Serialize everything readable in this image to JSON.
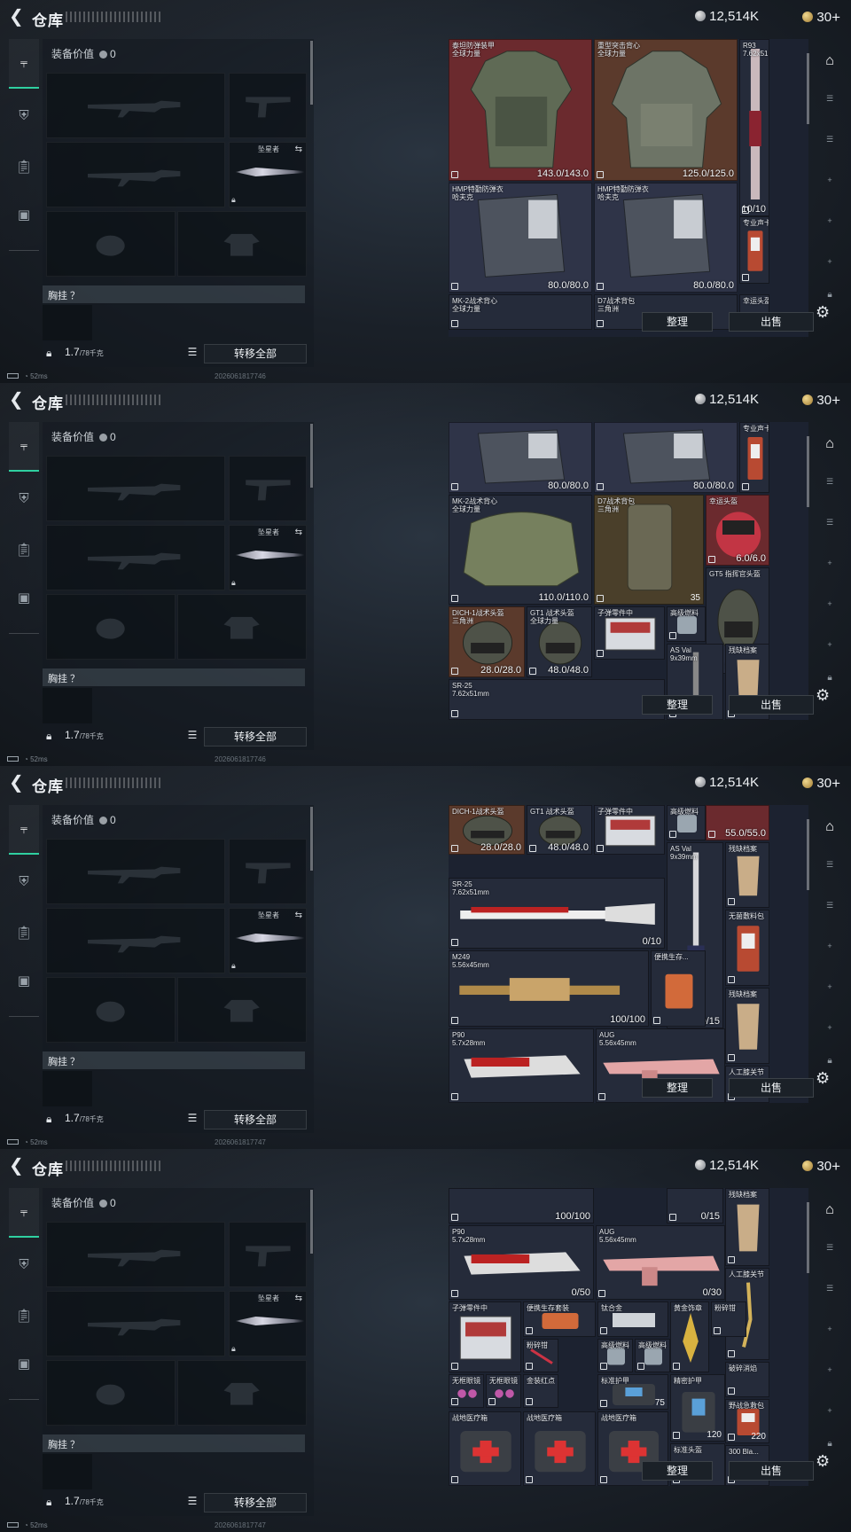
{
  "header": {
    "title": "仓库",
    "currency_silver": "12,514K",
    "currency_gold": "30"
  },
  "loadout": {
    "equip_value_label": "装备价值",
    "equip_value": "0",
    "melee_name": "坠星者",
    "vest_label": "胸挂 ？",
    "weight": "1.7",
    "weight_max": "/78千克",
    "transfer_all": "转移全部"
  },
  "actions": {
    "sort": "整理",
    "sell": "出售"
  },
  "status": {
    "ping": "52ms",
    "timestamps": [
      "2026061817746",
      "2026061817746",
      "2026061817747",
      "2026061817747"
    ]
  },
  "frames": [
    {
      "cells": [
        {
          "name": "泰坦防弹装甲\n全球力量",
          "value": "143.0/143.0"
        },
        {
          "name": "重型突击背心\n全球力量",
          "value": "125.0/125.0"
        },
        {
          "name": "R93\n7.62x51...",
          "value": "10/10"
        },
        {
          "name": "HMP特勤防弹衣\n哈夫克",
          "value": "80.0/80.0"
        },
        {
          "name": "HMP特勤防弹衣\n哈夫克",
          "value": "80.0/80.0"
        },
        {
          "name": "专业声卡",
          "value": ""
        },
        {
          "name": "MK-2战术背心\n全球力量",
          "value": ""
        },
        {
          "name": "D7战术背包\n三角洲",
          "value": ""
        },
        {
          "name": "幸运头盔",
          "value": ""
        }
      ]
    },
    {
      "cells": [
        {
          "name": "",
          "value": "80.0/80.0"
        },
        {
          "name": "",
          "value": "80.0/80.0"
        },
        {
          "name": "专业声卡",
          "value": ""
        },
        {
          "name": "MK-2战术背心\n全球力量",
          "value": "110.0/110.0"
        },
        {
          "name": "D7战术背包\n三角洲",
          "value": "35"
        },
        {
          "name": "幸运头盔",
          "value": "6.0/6.0"
        },
        {
          "name": "GT5 指挥官头盔",
          "value": "55.0/55.0"
        },
        {
          "name": "DICH-1战术头盔\n三角洲",
          "value": "28.0/28.0"
        },
        {
          "name": "GT1 战术头盔\n全球力量",
          "value": "48.0/48.0"
        },
        {
          "name": "子弹零件中",
          "value": ""
        },
        {
          "name": "高级燃料",
          "value": ""
        },
        {
          "name": "AS Val\n9x39mm",
          "value": ""
        },
        {
          "name": "残缺档案",
          "value": ""
        },
        {
          "name": "SR-25\n7.62x51mm",
          "value": ""
        }
      ]
    },
    {
      "cells": [
        {
          "name": "DICH-1战术头盔",
          "value": "28.0/28.0"
        },
        {
          "name": "GT1 战术头盔",
          "value": "48.0/48.0"
        },
        {
          "name": "子弹零件中",
          "value": ""
        },
        {
          "name": "高级燃料",
          "value": ""
        },
        {
          "name": "",
          "value": "55.0/55.0"
        },
        {
          "name": "AS Val\n9x39mm",
          "value": "0/15"
        },
        {
          "name": "残缺档案",
          "value": ""
        },
        {
          "name": "SR-25\n7.62x51mm",
          "value": "0/10"
        },
        {
          "name": "无菌敷料包",
          "value": ""
        },
        {
          "name": "M249\n5.56x45mm",
          "value": "100/100"
        },
        {
          "name": "便携生存...",
          "value": ""
        },
        {
          "name": "残缺档案",
          "value": ""
        },
        {
          "name": "P90\n5.7x28mm",
          "value": ""
        },
        {
          "name": "AUG\n5.56x45mm",
          "value": ""
        },
        {
          "name": "人工膝关节",
          "value": ""
        }
      ]
    },
    {
      "cells": [
        {
          "name": "",
          "value": "100/100"
        },
        {
          "name": "",
          "value": "0/15"
        },
        {
          "name": "残缺档案",
          "value": ""
        },
        {
          "name": "P90\n5.7x28mm",
          "value": "0/50"
        },
        {
          "name": "AUG\n5.56x45mm",
          "value": "0/30"
        },
        {
          "name": "人工膝关节",
          "value": ""
        },
        {
          "name": "子弹零件中",
          "value": ""
        },
        {
          "name": "便携生存套装",
          "value": ""
        },
        {
          "name": "钛合金",
          "value": ""
        },
        {
          "name": "黄金饰章",
          "value": ""
        },
        {
          "name": "粉碎钳",
          "value": ""
        },
        {
          "name": "粉碎钳",
          "value": ""
        },
        {
          "name": "高级燃料",
          "value": ""
        },
        {
          "name": "高级燃料",
          "value": ""
        },
        {
          "name": "破碎消焰",
          "value": ""
        },
        {
          "name": "无框眼镜",
          "value": ""
        },
        {
          "name": "无框眼镜",
          "value": ""
        },
        {
          "name": "金装红点",
          "value": ""
        },
        {
          "name": "标准护甲",
          "value": "75"
        },
        {
          "name": "精密护甲",
          "value": "120"
        },
        {
          "name": "野战急救包",
          "value": "220"
        },
        {
          "name": "战地医疗箱",
          "value": ""
        },
        {
          "name": "战地医疗箱",
          "value": ""
        },
        {
          "name": "战地医疗箱",
          "value": ""
        },
        {
          "name": "标准头盔",
          "value": ""
        },
        {
          "name": "300 Bla...",
          "value": ""
        }
      ]
    }
  ]
}
